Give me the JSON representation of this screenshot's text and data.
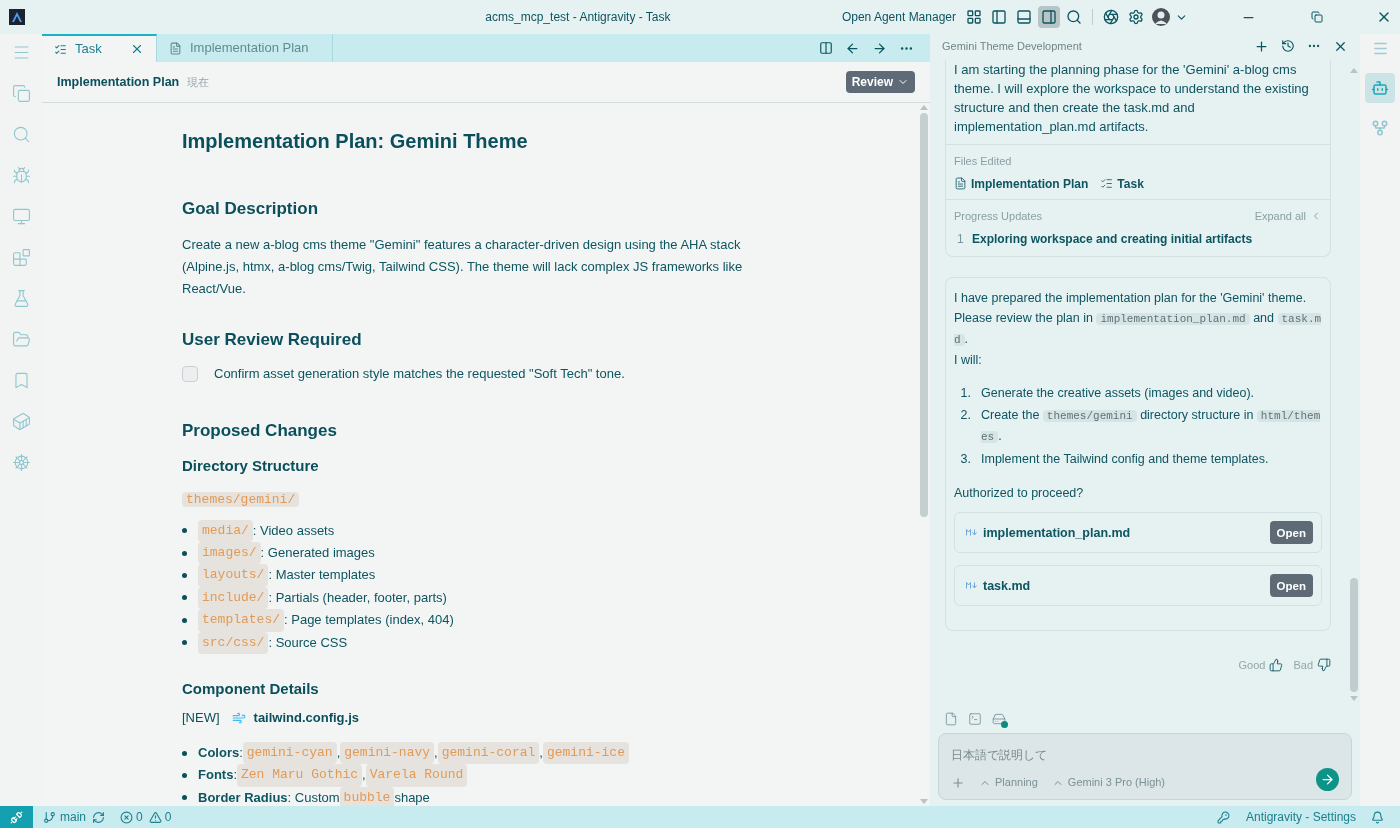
{
  "window": {
    "title": "acms_mcp_test - Antigravity - Task"
  },
  "title_bar": {
    "agent_manager": "Open Agent Manager",
    "layout_toggles": [
      {
        "kind": "grid",
        "selected": false
      },
      {
        "kind": "left",
        "selected": false
      },
      {
        "kind": "bottom",
        "selected": false
      },
      {
        "kind": "right",
        "selected": true
      }
    ]
  },
  "editor_tabs": [
    {
      "label": "Task",
      "kind": "checklist",
      "selected": true
    },
    {
      "label": "Implementation Plan",
      "kind": "document",
      "selected": false
    }
  ],
  "doc_header": {
    "title": "Implementation Plan",
    "subtitle": "現在",
    "review_button": "Review"
  },
  "document": [
    {
      "kind": "h1",
      "text": "Implementation Plan: Gemini Theme"
    },
    {
      "kind": "h2",
      "text": "Goal Description"
    },
    {
      "kind": "p",
      "text": "Create a new a-blog cms theme \"Gemini\" features a character-driven design using the AHA stack (Alpine.js, htmx, a-blog cms/Twig, Tailwind CSS). The theme will lack complex JS frameworks like React/Vue."
    },
    {
      "kind": "h2",
      "text": "User Review Required"
    },
    {
      "kind": "task",
      "text": "Confirm asset generation style matches the requested \"Soft Tech\" tone.",
      "checked": false
    },
    {
      "kind": "h2",
      "text": "Proposed Changes"
    },
    {
      "kind": "h3",
      "text": "Directory Structure"
    },
    {
      "kind": "code",
      "text": "themes/gemini/"
    },
    {
      "kind": "list",
      "items": [
        {
          "segments": [
            {
              "kind": "code",
              "text": "media/"
            },
            {
              "kind": "text",
              "text": ": Video assets"
            }
          ]
        },
        {
          "segments": [
            {
              "kind": "code",
              "text": "images/"
            },
            {
              "kind": "text",
              "text": ": Generated images"
            }
          ]
        },
        {
          "segments": [
            {
              "kind": "code",
              "text": "layouts/"
            },
            {
              "kind": "text",
              "text": ": Master templates"
            }
          ]
        },
        {
          "segments": [
            {
              "kind": "code",
              "text": "include/"
            },
            {
              "kind": "text",
              "text": ": Partials (header, footer, parts)"
            }
          ]
        },
        {
          "segments": [
            {
              "kind": "code",
              "text": "templates/"
            },
            {
              "kind": "text",
              "text": ": Page templates (index, 404)"
            }
          ]
        },
        {
          "segments": [
            {
              "kind": "code",
              "text": "src/css/"
            },
            {
              "kind": "text",
              "text": ": Source CSS"
            }
          ]
        }
      ]
    },
    {
      "kind": "h3",
      "text": "Component Details"
    },
    {
      "kind": "file",
      "tag": "[NEW]",
      "text": "tailwind.config.js"
    },
    {
      "kind": "list",
      "items": [
        {
          "segments": [
            {
              "kind": "bold",
              "text": "Colors"
            },
            {
              "kind": "text",
              "text": ": "
            },
            {
              "kind": "code",
              "text": "gemini-cyan"
            },
            {
              "kind": "text",
              "text": ", "
            },
            {
              "kind": "code",
              "text": "gemini-navy"
            },
            {
              "kind": "text",
              "text": ", "
            },
            {
              "kind": "code",
              "text": "gemini-coral"
            },
            {
              "kind": "text",
              "text": ", "
            },
            {
              "kind": "code",
              "text": "gemini-ice"
            }
          ]
        },
        {
          "segments": [
            {
              "kind": "bold",
              "text": "Fonts"
            },
            {
              "kind": "text",
              "text": ": "
            },
            {
              "kind": "code",
              "text": "Zen Maru Gothic"
            },
            {
              "kind": "text",
              "text": ", "
            },
            {
              "kind": "code",
              "text": "Varela Round"
            }
          ]
        },
        {
          "segments": [
            {
              "kind": "bold",
              "text": "Border Radius"
            },
            {
              "kind": "text",
              "text": ": Custom "
            },
            {
              "kind": "code",
              "text": "bubble"
            },
            {
              "kind": "text",
              "text": " shape"
            }
          ]
        }
      ]
    }
  ],
  "chat": {
    "title": "Gemini Theme Development",
    "progress_card": {
      "text": "I am starting the planning phase for the 'Gemini' a-blog cms theme. I will explore the workspace to understand the existing structure and then create the task.md and implementation_plan.md artifacts.",
      "files_label": "Files Edited",
      "files": [
        {
          "kind": "document",
          "label": "Implementation Plan"
        },
        {
          "kind": "checklist",
          "label": "Task"
        }
      ],
      "progress_label": "Progress Updates",
      "expand": "Expand all",
      "steps": [
        {
          "number": "1",
          "text": "Exploring workspace and creating initial artifacts"
        }
      ]
    },
    "message": {
      "intro": [
        {
          "kind": "text",
          "text": "I have prepared the implementation plan for the 'Gemini' theme. Please review the plan in "
        },
        {
          "kind": "code",
          "text": "implementation_plan.md"
        },
        {
          "kind": "text",
          "text": " and "
        },
        {
          "kind": "code",
          "text": "task.md"
        },
        {
          "kind": "text",
          "text": "."
        }
      ],
      "lead": "I will:",
      "steps": [
        {
          "number": "1.",
          "segments": [
            {
              "kind": "text",
              "text": "Generate the creative assets (images and video)."
            }
          ]
        },
        {
          "number": "2.",
          "segments": [
            {
              "kind": "text",
              "text": "Create the "
            },
            {
              "kind": "code",
              "text": "themes/gemini"
            },
            {
              "kind": "text",
              "text": " directory structure in "
            },
            {
              "kind": "code",
              "text": "html/themes"
            },
            {
              "kind": "text",
              "text": "."
            }
          ]
        },
        {
          "number": "3.",
          "segments": [
            {
              "kind": "text",
              "text": "Implement the Tailwind config and theme templates."
            }
          ]
        }
      ],
      "question": "Authorized to proceed?",
      "files": [
        {
          "name": "implementation_plan.md",
          "button": "Open"
        },
        {
          "name": "task.md",
          "button": "Open"
        }
      ]
    },
    "feedback": [
      {
        "kind": "up",
        "label": "Good"
      },
      {
        "kind": "down",
        "label": "Bad"
      }
    ],
    "input": {
      "placeholder": "日本語で説明して",
      "mode": "Planning",
      "model": "Gemini 3 Pro (High)"
    }
  },
  "right_bar": [
    {
      "kind": "agent",
      "selected": true
    },
    {
      "kind": "branch",
      "selected": false
    }
  ],
  "status_bar": {
    "branch": "main",
    "errors": "0",
    "warnings": "0",
    "settings": "Antigravity - Settings"
  }
}
